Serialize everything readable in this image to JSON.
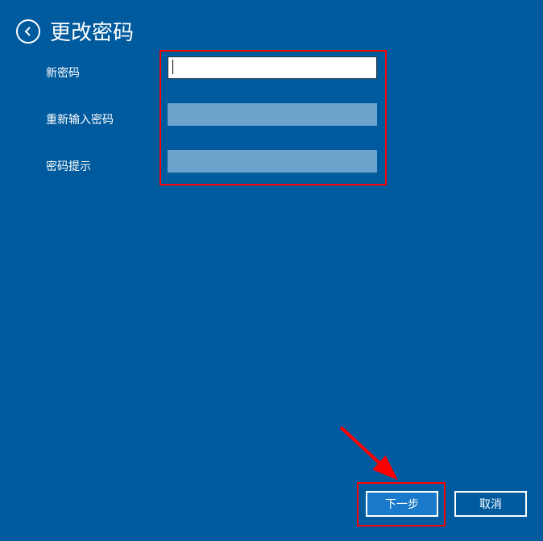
{
  "header": {
    "title": "更改密码"
  },
  "form": {
    "newPasswordLabel": "新密码",
    "reenterPasswordLabel": "重新输入密码",
    "passwordHintLabel": "密码提示",
    "newPasswordValue": "",
    "reenterPasswordValue": "",
    "passwordHintValue": ""
  },
  "buttons": {
    "next": "下一步",
    "cancel": "取消"
  }
}
